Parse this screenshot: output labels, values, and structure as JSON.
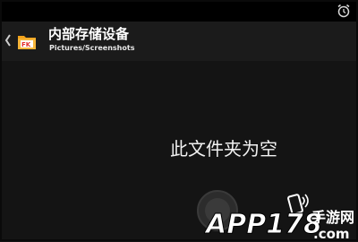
{
  "statusbar": {
    "icon": "alarm-clock-icon"
  },
  "actionbar": {
    "back_icon": "chevron-left-icon",
    "app_icon": "fk-folder-icon",
    "title": "内部存储设备",
    "path": "Pictures/Screenshots"
  },
  "content": {
    "empty_message": "此文件夹为空"
  },
  "watermark": {
    "text": "APP178.com",
    "cn_text": "手游网"
  },
  "colors": {
    "background": "#141414",
    "actionbar": "#1b1b1b",
    "folder_accent": "#f2a21a",
    "fk_red": "#e5302b"
  }
}
